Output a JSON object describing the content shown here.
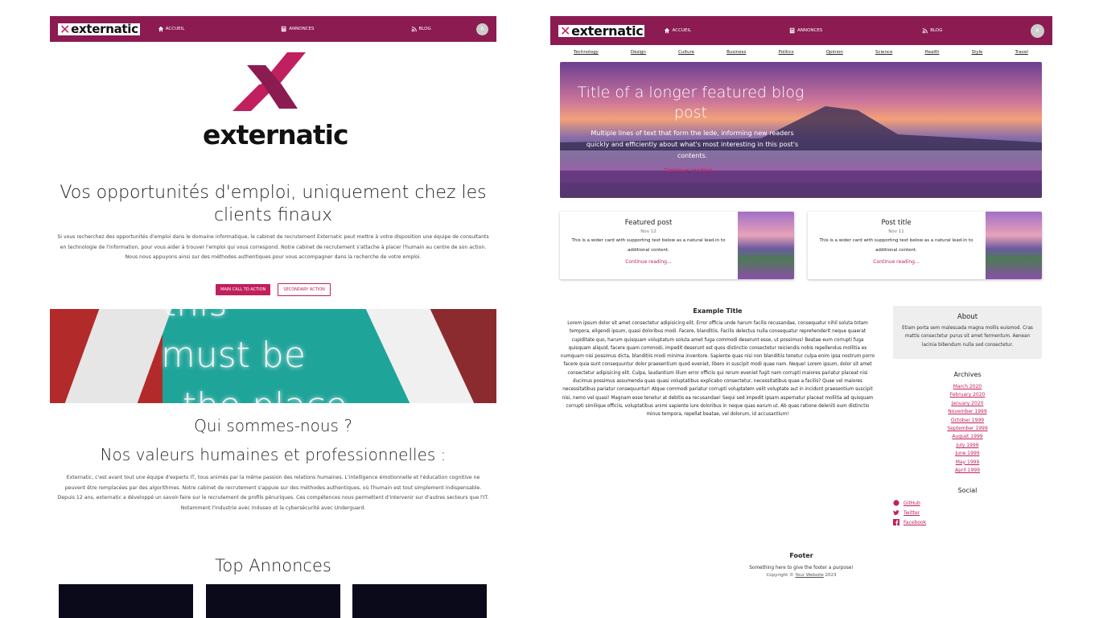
{
  "left_page": {
    "nav": {
      "logo": "externatic",
      "links": [
        "ACCUEIL",
        "ANNONCES",
        "BLOG"
      ],
      "avatar": "R"
    },
    "hero": {
      "logo_wordmark": "externatic",
      "title": "Vos opportunités d'emploi, uniquement chez les clients finaux",
      "text": "Si vous recherchez des opportunités d'emploi dans le domaine informatique, le cabinet de recrutement Externatic peut mettre à votre disposition une équipe de consultants en technologie de l'information, pour vous aider à trouver l'emploi qui vous correspond. Notre cabinet de recrutement s'attache à placer l'humain au centre de son action. Nous nous appuyons ainsi sur des méthodes authentiques pour vous accompagner dans la recherche de votre emploi.",
      "primary_button": "MAIN CALL TO ACTION",
      "secondary_button": "SECONDARY ACTION"
    },
    "neon_image": {
      "lines": [
        "this",
        "must be",
        "the place"
      ]
    },
    "about": {
      "title": "Qui sommes-nous ?",
      "subtitle": "Nos valeurs humaines et professionnelles :",
      "text": "Externatic, c'est avant tout une équipe d'experts IT, tous animés par la même passion des relations humaines. L'intelligence émotionnelle et l'éducation cognitive ne peuvent être remplacées par des algorithmes. Notre cabinet de recrutement s'appuie sur des méthodes authentiques, où l'humain est tout simplement indispensable. Depuis 12 ans, externatic a développé un savoir-faire sur le recrutement de profils pénuriques. Ces compétences nous permettent d'intervenir sur d'autres secteurs que l'IT. Notamment l'industrie avec Induseo et la cybersécurité avec Underguard."
    },
    "top": {
      "title": "Top Annonces"
    }
  },
  "right_page": {
    "nav": {
      "logo": "externatic",
      "links": [
        "ACCUEIL",
        "ANNONCES",
        "BLOG"
      ],
      "avatar": "R"
    },
    "categories": [
      "Technology",
      "Design",
      "Culture",
      "Business",
      "Politics",
      "Opinion",
      "Science",
      "Health",
      "Style",
      "Travel"
    ],
    "featured": {
      "title": "Title of a longer featured blog post",
      "lede": "Multiple lines of text that form the lede, informing new readers quickly and efficiently about what's most interesting in this post's contents.",
      "link": "Continue reading..."
    },
    "cards": [
      {
        "title": "Featured post",
        "date": "Nov 12",
        "text": "This is a wider card with supporting text below as a natural lead-in to additional content.",
        "link": "Continue reading..."
      },
      {
        "title": "Post title",
        "date": "Nov 11",
        "text": "This is a wider card with supporting text below as a natural lead-in to additional content.",
        "link": "Continue reading..."
      }
    ],
    "article": {
      "title": "Example Title",
      "text": "Lorem ipsum dolor sit amet consectetur adipisicing elit. Error officia unde harum facilis recusandae, consequatur nihil soluta totam tempora, eligendi ipsum, quasi doloribus modi. Facere, blanditiis. Facilis delectus nulla consequatur reprehenderit neque quaerat cupiditate quo, harum quisquam voluptatum soluta amet fuga commodi deserunt esse, ut possimus! Beatae eum corrupti fuga quisquam aliquid, facere quam commodi, impedit deserunt est quos distinctio consectetur reiciendis nobis repellendus mollitia ex numquam nisi possimus dicta, blanditiis modi minima inventore. Sapiente quas nisi non blanditiis tenetur culpa enim ipsa nostrum porro facere quia sunt consequuntur dolor praesentium quod eveniet, libero in suscipit modi quae nam. Neque! Lorem ipsum, dolor sit amet consectetur adipisicing elit. Culpa, laudantium illum error officiis qui rerum eveniet fugit nam corrupti maiores pariatur placeat nisi ducimus possimus assumenda quas quasi voluptatibus explicabo consectetur, necessitatibus quae a facilis? Quae vel maiores necessitatibus pariatur consequuntur! Atque commodi pariatur corrupti voluptatem velit voluptate aut in incidunt praesentium suscipit nisi, nemo vel quasi! Magnam esse tenetur at debitis ea recusandae! Sequi sed impedit ipsam aspernatur placeat mollitia ad quisquam corrupti similique officiis, voluptatibus animi sapiente iure doloribus in neque quas earum ut. Ab quas ratione deleniti eum distinctio minus tempora, repellat beatae, vel dolorum, id accusantium!"
    },
    "sidebar": {
      "about_title": "About",
      "about_text": "Etiam porta sem malesuada magna mollis euismod. Cras mattis consectetur purus sit amet fermentum. Aenean lacinia bibendum nulla sed consectetur.",
      "archives_title": "Archives",
      "archives": [
        "March 2020",
        "February 2020",
        "January 2020",
        "November 1999",
        "October 1999",
        "September 1999",
        "August 1999",
        "July 1999",
        "June 1999",
        "May 1999",
        "April 1999"
      ],
      "social_title": "Social",
      "social": [
        "GitHub",
        "Twitter",
        "Facebook"
      ]
    },
    "footer": {
      "title": "Footer",
      "text": "Something here to give the footer a purpose!",
      "copyright_prefix": "Copyright ©",
      "copyright_link": "Your Website",
      "copyright_year": "2023"
    }
  },
  "colors": {
    "brand": "#8c1b52",
    "accent": "#c0205d"
  }
}
